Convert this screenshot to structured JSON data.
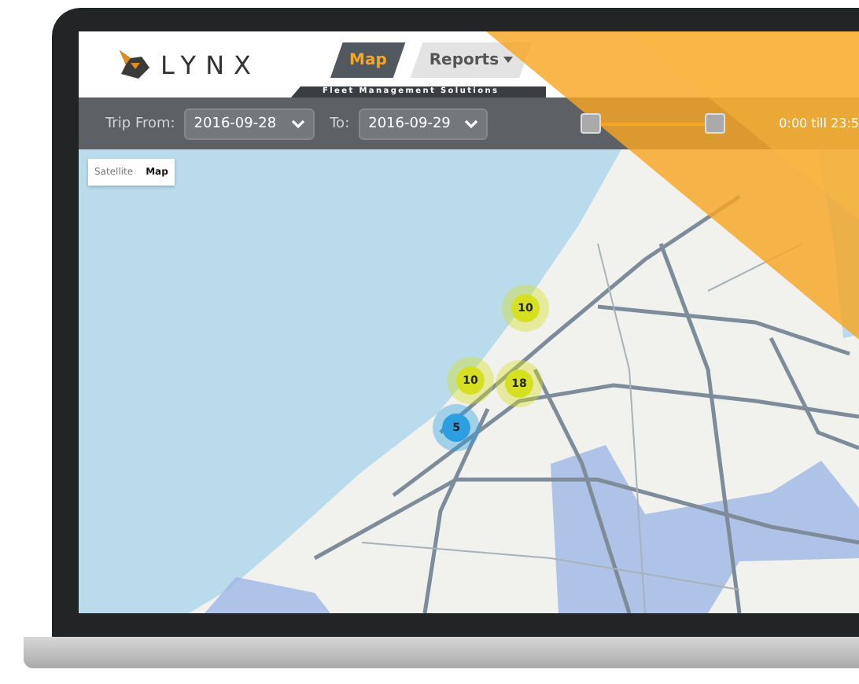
{
  "header": {
    "logo": "LYNX",
    "tagline": "Fleet Management Solutions",
    "tabs": [
      {
        "label": "Map",
        "selected": true,
        "dropdown": false
      },
      {
        "label": "Reports",
        "selected": false,
        "dropdown": true
      }
    ]
  },
  "filter": {
    "from_label": "Trip From:",
    "from_value": "2016-09-28",
    "to_label": "To:",
    "to_value": "2016-09-29",
    "time_slider": {
      "level": 1
    },
    "time_range": "0:00 till 23:5"
  },
  "map": {
    "view_toggle": [
      {
        "label": "Satellite",
        "selected": false
      },
      {
        "label": "Map",
        "selected": true
      }
    ],
    "clusters": [
      {
        "count": "10",
        "color": "#d6e021"
      },
      {
        "count": "10",
        "color": "#d6e021"
      },
      {
        "count": "18",
        "color": "#d6e021"
      },
      {
        "count": "5",
        "color": "#2b9fe0"
      }
    ]
  }
}
